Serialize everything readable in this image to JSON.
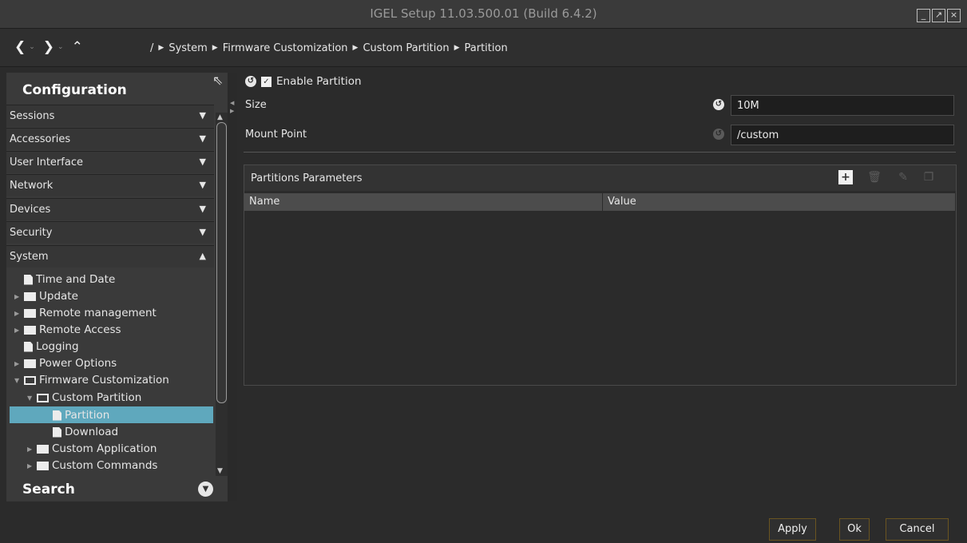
{
  "window": {
    "title": "IGEL Setup 11.03.500.01 (Build 6.4.2)",
    "buttons": [
      "_",
      "↗",
      "×"
    ]
  },
  "nav": {
    "back": "❮",
    "forward": "❯",
    "up": "⌃",
    "dropdown": "⌄",
    "breadcrumbs": [
      "/",
      "System",
      "Firmware Customization",
      "Custom Partition",
      "Partition"
    ]
  },
  "sidebar": {
    "title": "Configuration",
    "categories": [
      {
        "label": "Sessions",
        "arrow": "▼"
      },
      {
        "label": "Accessories",
        "arrow": "▼"
      },
      {
        "label": "User Interface",
        "arrow": "▼"
      },
      {
        "label": "Network",
        "arrow": "▼"
      },
      {
        "label": "Devices",
        "arrow": "▼"
      },
      {
        "label": "Security",
        "arrow": "▼"
      },
      {
        "label": "System",
        "arrow": "▲"
      }
    ],
    "tree": [
      {
        "label": "Time and Date"
      },
      {
        "label": "Update"
      },
      {
        "label": "Remote management"
      },
      {
        "label": "Remote Access"
      },
      {
        "label": "Logging"
      },
      {
        "label": "Power Options"
      },
      {
        "label": "Firmware Customization"
      },
      {
        "label": "Custom Partition"
      },
      {
        "label": "Partition"
      },
      {
        "label": "Download"
      },
      {
        "label": "Custom Application"
      },
      {
        "label": "Custom Commands"
      }
    ],
    "search_label": "Search"
  },
  "main": {
    "enable_label": "Enable Partition",
    "enable_checked": true,
    "size_label": "Size",
    "size_value": "10M",
    "mount_label": "Mount Point",
    "mount_value": "/custom",
    "params_title": "Partitions Parameters",
    "columns": [
      "Name",
      "Value"
    ]
  },
  "footer": {
    "apply": "Apply",
    "ok": "Ok",
    "cancel": "Cancel"
  },
  "colors": {
    "selected": "#5fa8bd",
    "button_border": "#6a5420"
  }
}
